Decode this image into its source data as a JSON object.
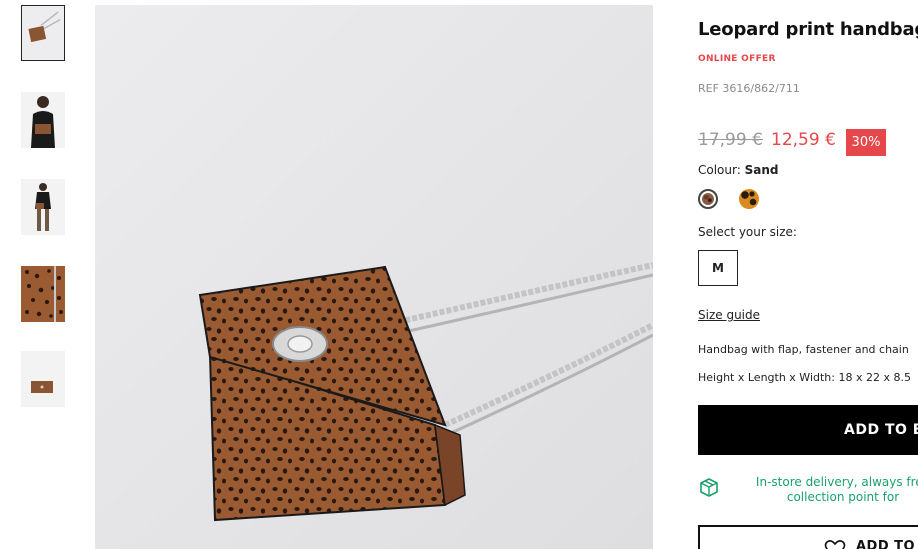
{
  "gallery": {
    "thumbnails": [
      {
        "name": "bag-on-floor",
        "selected": true
      },
      {
        "name": "model-wearing-bag",
        "selected": false
      },
      {
        "name": "model-full-body",
        "selected": false
      },
      {
        "name": "texture-detail",
        "selected": false
      },
      {
        "name": "bag-flat",
        "selected": false
      }
    ]
  },
  "product": {
    "title": "Leopard print handbag",
    "offer_label": "ONLINE OFFER",
    "ref": "REF 3616/862/711",
    "old_price": "17,99 €",
    "new_price": "12,59 €",
    "discount": "30%",
    "colour_label": "Colour:",
    "colour_value": "Sand",
    "swatches": [
      {
        "name": "sand",
        "selected": true
      },
      {
        "name": "orange-leopard",
        "selected": false
      }
    ],
    "size_label": "Select your size:",
    "size_value": "M",
    "size_guide": "Size guide",
    "description_1": "Handbag with flap, fastener and chain",
    "description_2": "Height x Length x Width: 18 x 22 x 8.5",
    "add_to_bag": "ADD TO BA",
    "delivery_text": "In-store delivery, always free collection point for",
    "add_to_wishlist": "ADD TO W"
  },
  "colors": {
    "accent_red": "#e5474b",
    "delivery_green": "#1aa06d",
    "button_black": "#000000"
  }
}
